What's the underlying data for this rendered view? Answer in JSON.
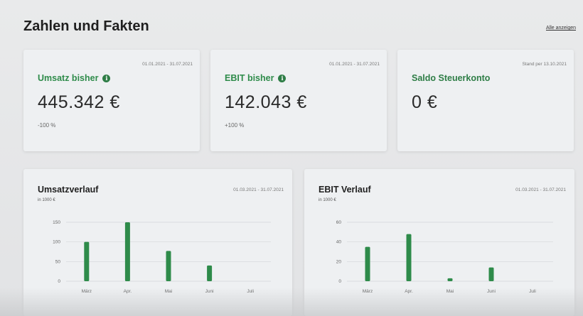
{
  "header": {
    "title": "Zahlen und Fakten",
    "show_all": "Alle anzeigen"
  },
  "kpis": [
    {
      "date_range": "01.01.2021 - 31.07.2021",
      "label": "Umsatz bisher",
      "has_info": true,
      "value": "445.342 €",
      "change": "-100 %"
    },
    {
      "date_range": "01.01.2021 - 31.07.2021",
      "label": "EBIT bisher",
      "has_info": true,
      "value": "142.043 €",
      "change": "+100 %"
    },
    {
      "date_range": "Stand per 13.10.2021",
      "label": "Saldo Steuerkonto",
      "has_info": false,
      "value": "0 €",
      "change": ""
    }
  ],
  "colors": {
    "accent": "#2e8b4a",
    "card_bg": "#eef0f2"
  },
  "charts": [
    {
      "title": "Umsatzverlauf",
      "unit": "in 1000 €",
      "date_range": "01.03.2021 - 31.07.2021"
    },
    {
      "title": "EBIT Verlauf",
      "unit": "in 1000 €",
      "date_range": "01.03.2021 - 31.07.2021"
    }
  ],
  "chart_data": [
    {
      "type": "bar",
      "title": "Umsatzverlauf",
      "ylabel": "in 1000 €",
      "categories": [
        "März",
        "Apr.",
        "Mai",
        "Juni",
        "Juli"
      ],
      "values": [
        100,
        150,
        77,
        40,
        0
      ],
      "yticks": [
        0,
        50,
        100,
        150
      ],
      "ylim": [
        0,
        150
      ],
      "grid": true
    },
    {
      "type": "bar",
      "title": "EBIT Verlauf",
      "ylabel": "in 1000 €",
      "categories": [
        "März",
        "Apr.",
        "Mai",
        "Juni",
        "Juli"
      ],
      "values": [
        35,
        48,
        3,
        14,
        0
      ],
      "yticks": [
        0,
        20,
        40,
        60
      ],
      "ylim": [
        0,
        60
      ],
      "grid": true
    }
  ]
}
